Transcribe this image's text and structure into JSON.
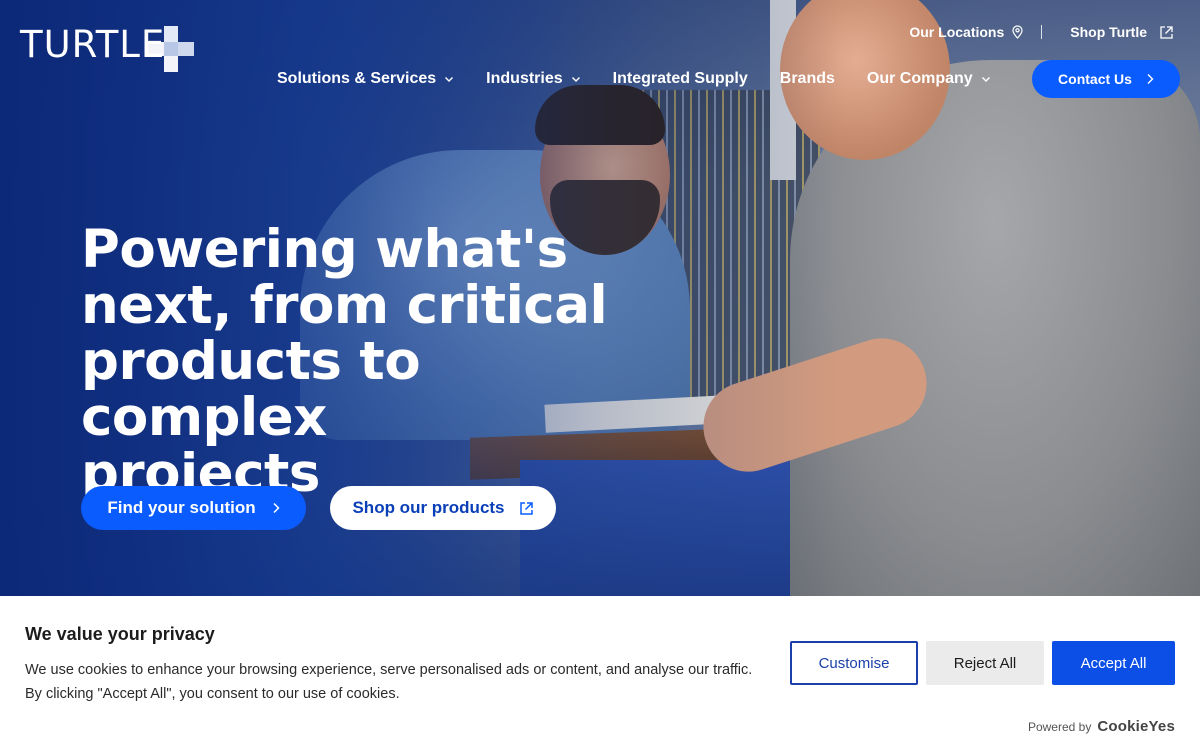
{
  "brand": {
    "logo_text": "TURTLE"
  },
  "utility_nav": {
    "locations_label": "Our Locations",
    "shop_label": "Shop Turtle"
  },
  "main_nav": {
    "items": [
      {
        "label": "Solutions & Services",
        "has_dropdown": true
      },
      {
        "label": "Industries",
        "has_dropdown": true
      },
      {
        "label": "Integrated Supply",
        "has_dropdown": false
      },
      {
        "label": "Brands",
        "has_dropdown": false
      },
      {
        "label": "Our Company",
        "has_dropdown": true
      }
    ],
    "contact_label": "Contact Us"
  },
  "hero": {
    "headline_lines": [
      "Powering what's",
      "next, from critical",
      "products to complex",
      "projects"
    ],
    "primary_cta": "Find your solution",
    "secondary_cta": "Shop our products"
  },
  "cookie_banner": {
    "title": "We value your privacy",
    "text_line1": "We use cookies to enhance your browsing experience, serve personalised ads or content, and analyse our traffic.",
    "text_line2": "By clicking \"Accept All\", you consent to our use of cookies.",
    "customise_label": "Customise",
    "reject_label": "Reject All",
    "accept_label": "Accept All",
    "powered_by_label": "Powered by",
    "powered_by_brand": "CookieYes"
  },
  "colors": {
    "accent_blue": "#0a5cff",
    "accept_blue": "#0b4fe6",
    "customise_border": "#1a3fa8",
    "hero_overlay": "#0c2878"
  }
}
